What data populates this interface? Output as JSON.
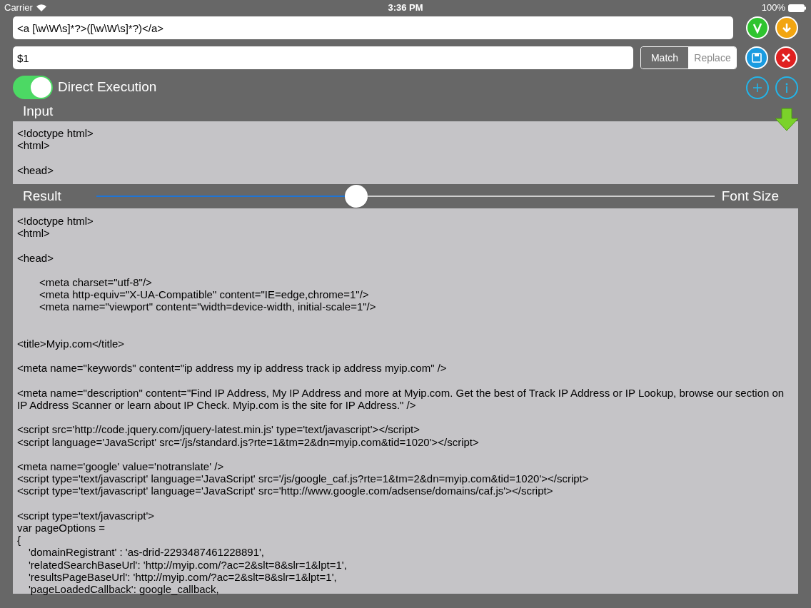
{
  "status_bar": {
    "carrier": "Carrier",
    "time": "3:36 PM",
    "battery": "100%"
  },
  "pattern": {
    "value": "<a [\\w\\W\\s]*?>([\\w\\W\\s]*?)</a>"
  },
  "replacement": {
    "value": "$1"
  },
  "mode_tabs": [
    {
      "label": "Match",
      "selected": true
    },
    {
      "label": "Replace",
      "selected": false
    }
  ],
  "direct_execution": {
    "label": "Direct Execution",
    "on": true
  },
  "input": {
    "label": "Input",
    "blocks": [
      [
        "<!doctype html>",
        "<html>"
      ],
      [
        "<head>"
      ]
    ]
  },
  "result_bar": {
    "label": "Result",
    "font_size_label": "Font Size",
    "level": 0.42
  },
  "result": {
    "blocks": [
      {
        "kind": "top",
        "lines": [
          "<!doctype html>",
          "<html>"
        ]
      },
      {
        "kind": "plain",
        "lines": [
          "<head>"
        ]
      },
      {
        "kind": "indented",
        "lines": [
          "<meta charset=\"utf-8\"/>",
          "<meta http-equiv=\"X-UA-Compatible\" content=\"IE=edge,chrome=1\"/>",
          "<meta name=\"viewport\" content=\"width=device-width, initial-scale=1\"/>"
        ]
      },
      {
        "kind": "spaced",
        "lines": [
          "<title>Myip.com</title>"
        ]
      },
      {
        "kind": "plain",
        "lines": [
          "<meta name=\"keywords\" content=\"ip address my ip address track ip address myip.com\" />"
        ]
      },
      {
        "kind": "plain",
        "lines": [
          "<meta name=\"description\" content=\"Find IP Address, My IP Address and more at Myip.com. Get the best of Track IP Address or IP Lookup, browse our section on IP Address Scanner or learn about IP Check. Myip.com is the site for IP Address.\" />"
        ]
      },
      {
        "kind": "plain",
        "lines": [
          "<script src='http://code.jquery.com/jquery-latest.min.js' type='text/javascript'></script>",
          "<script language='JavaScript' src='/js/standard.js?rte=1&tm=2&dn=myip.com&tid=1020'></script>"
        ]
      },
      {
        "kind": "plain",
        "lines": [
          "<meta name='google' value='notranslate' />",
          "<script type='text/javascript' language='JavaScript' src='/js/google_caf.js?rte=1&tm=2&dn=myip.com&tid=1020'></script>",
          "<script type='text/javascript' language='JavaScript' src='http://www.google.com/adsense/domains/caf.js'></script>"
        ]
      },
      {
        "kind": "plain",
        "lines": [
          "<script type='text/javascript'>",
          "var pageOptions =",
          "{"
        ]
      },
      {
        "kind": "continuation",
        "lines": [
          "'domainRegistrant' : 'as-drid-2293487461228891',",
          "'relatedSearchBaseUrl': 'http://myip.com/?ac=2&slt=8&slr=1&lpt=1',",
          "'resultsPageBaseUrl': 'http://myip.com/?ac=2&slt=8&slr=1&lpt=1',",
          "'pageLoadedCallback': google_callback,"
        ]
      }
    ]
  }
}
